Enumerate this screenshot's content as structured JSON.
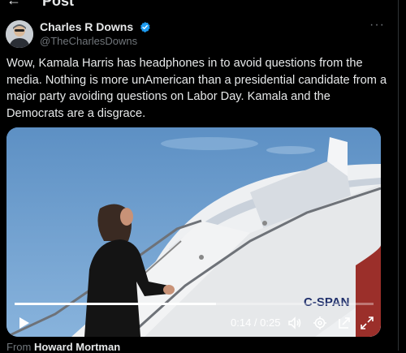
{
  "header": {
    "title": "Post",
    "back_icon": "arrow-left-icon"
  },
  "author": {
    "name": "Charles R Downs",
    "handle": "@TheCharlesDowns",
    "verified": true,
    "verified_color": "#1d9bf0",
    "more_icon": "more-horizontal-icon"
  },
  "post": {
    "text": "Wow, Kamala Harris has headphones in to avoid questions from the media. Nothing is more unAmerican than a presidential candidate from a major party avoiding questions on Labor Day. Kamala and the Democrats are a disgrace."
  },
  "video": {
    "watermark_left": "C",
    "watermark_dash": "-",
    "watermark_right": "SPAN",
    "time_text": "0:14 / 0:25",
    "progress": 0.56,
    "controls": [
      "play-icon",
      "volume-icon",
      "settings-icon",
      "popout-icon",
      "fullscreen-icon"
    ]
  },
  "attribution": {
    "prefix": "From",
    "source": "Howard Mortman"
  }
}
